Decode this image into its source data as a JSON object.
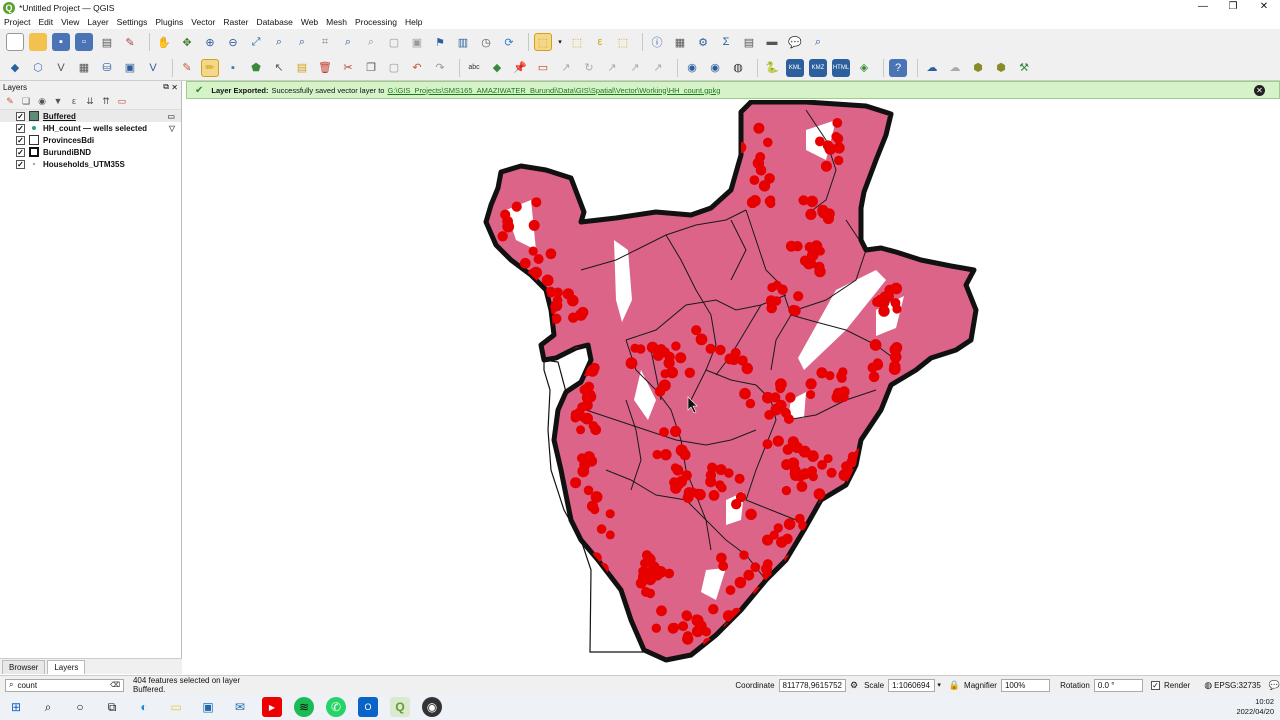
{
  "window": {
    "title": "*Untitled Project — QGIS",
    "controls": [
      "—",
      "❐",
      "✕"
    ]
  },
  "menu": [
    "Project",
    "Edit",
    "View",
    "Layer",
    "Settings",
    "Plugins",
    "Vector",
    "Raster",
    "Database",
    "Web",
    "Mesh",
    "Processing",
    "Help"
  ],
  "layers_panel": {
    "title": "Layers",
    "layers": [
      {
        "name": "Buffered",
        "checked": "✓"
      },
      {
        "name": "HH_count — wells selected",
        "checked": "✓"
      },
      {
        "name": "ProvincesBdi",
        "checked": "✓"
      },
      {
        "name": "BurundiBND",
        "checked": "✓"
      },
      {
        "name": "Households_UTM35S",
        "checked": "✓"
      }
    ],
    "tabs": [
      "Browser",
      "Layers"
    ]
  },
  "message": {
    "title": "Layer Exported:",
    "text": "Successfully saved vector layer to",
    "path": "G:\\GIS_Projects\\SMS165_AMAZIWATER_Burundi\\Data\\GIS\\Spatial\\Vector\\Working\\HH_count.gpkg"
  },
  "status": {
    "search_value": "count",
    "selection_msg": "404 features selected on layer Buffered.",
    "coordinate_label": "Coordinate",
    "coordinate_value": "811778,9615752",
    "scale_label": "Scale",
    "scale_value": "1:1060694",
    "magnifier_label": "Magnifier",
    "magnifier_value": "100%",
    "rotation_label": "Rotation",
    "rotation_value": "0.0 °",
    "render_label": "Render",
    "crs": "EPSG:32735"
  },
  "taskbar": {
    "time": "10:02",
    "date": "2022/04/20"
  },
  "colors": {
    "fill": "#dc6489",
    "points": "#e60000",
    "outline": "#111111",
    "message_bg": "#d6f2c9"
  },
  "icons": [
    "new-project-icon",
    "open-icon",
    "save-icon",
    "pan-icon",
    "zoom-in-icon",
    "zoom-out-icon",
    "identify-icon",
    "select-icon",
    "python-icon",
    "qgis-icon"
  ]
}
